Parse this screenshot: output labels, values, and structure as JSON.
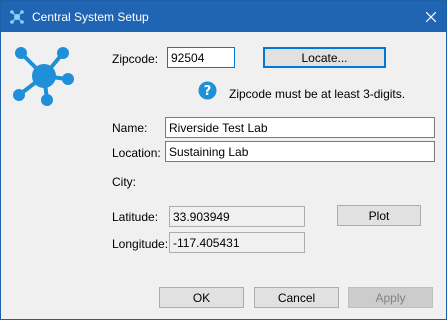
{
  "window": {
    "title": "Central System Setup"
  },
  "zipcode": {
    "label": "Zipcode:",
    "value": "92504"
  },
  "locate_button": "Locate...",
  "hint": "Zipcode must be at least 3-digits.",
  "name": {
    "label": "Name:",
    "value": "Riverside Test Lab"
  },
  "location": {
    "label": "Location:",
    "value": "Sustaining Lab"
  },
  "city": {
    "label": "City:"
  },
  "latitude": {
    "label": "Latitude:",
    "value": "33.903949"
  },
  "plot_button": "Plot",
  "longitude": {
    "label": "Longitude:",
    "value": "-117.405431"
  },
  "buttons": {
    "ok": "OK",
    "cancel": "Cancel",
    "apply": "Apply"
  },
  "icons": {
    "app": "network-hub-icon",
    "close": "close-icon",
    "info": "info-icon",
    "logo": "network-hub-logo"
  },
  "colors": {
    "titlebar": "#1f65b4",
    "accent": "#1e8fd8",
    "focus": "#0078d7"
  }
}
